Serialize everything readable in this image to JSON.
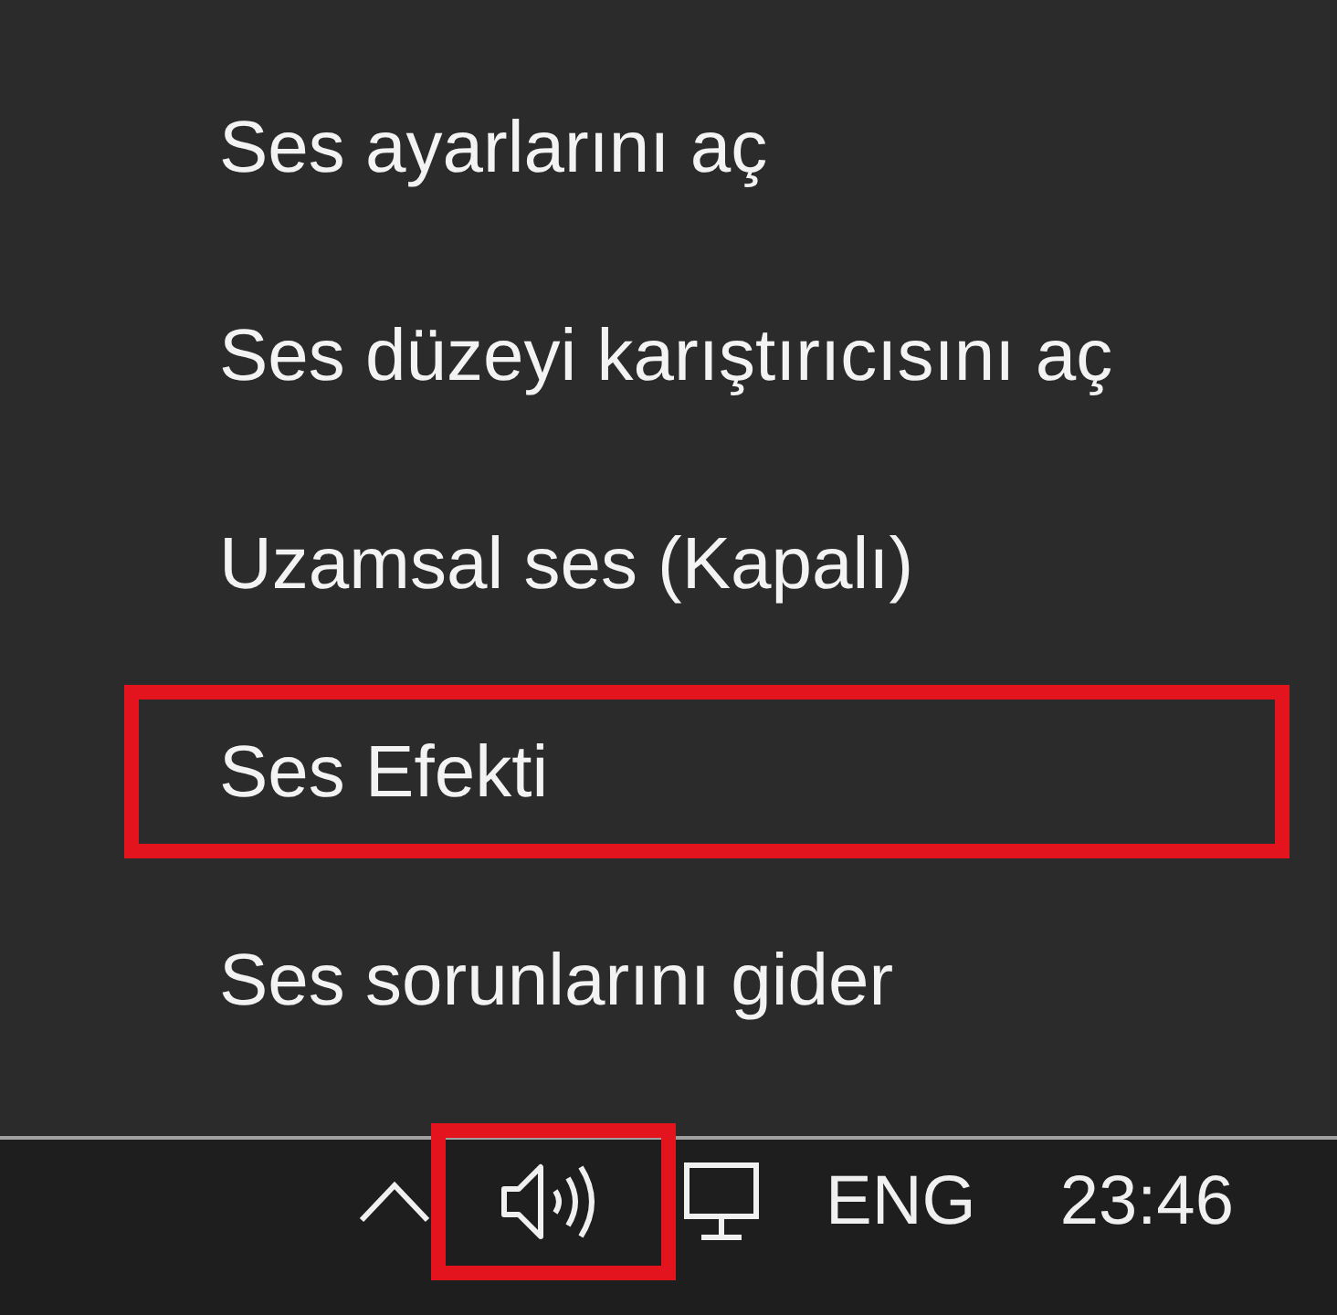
{
  "menu": {
    "items": [
      {
        "label": "Ses ayarlarını aç",
        "highlighted": false
      },
      {
        "label": "Ses düzeyi karıştırıcısını aç",
        "highlighted": false
      },
      {
        "label": "Uzamsal ses (Kapalı)",
        "highlighted": false
      },
      {
        "label": "Ses Efekti",
        "highlighted": true
      },
      {
        "label": "Ses sorunlarını gider",
        "highlighted": false
      }
    ]
  },
  "taskbar": {
    "tray_icons": [
      {
        "kind": "chevron",
        "highlighted": false
      },
      {
        "kind": "speaker",
        "highlighted": true
      },
      {
        "kind": "monitor",
        "highlighted": false
      }
    ],
    "language": "ENG",
    "time": "23:46"
  }
}
